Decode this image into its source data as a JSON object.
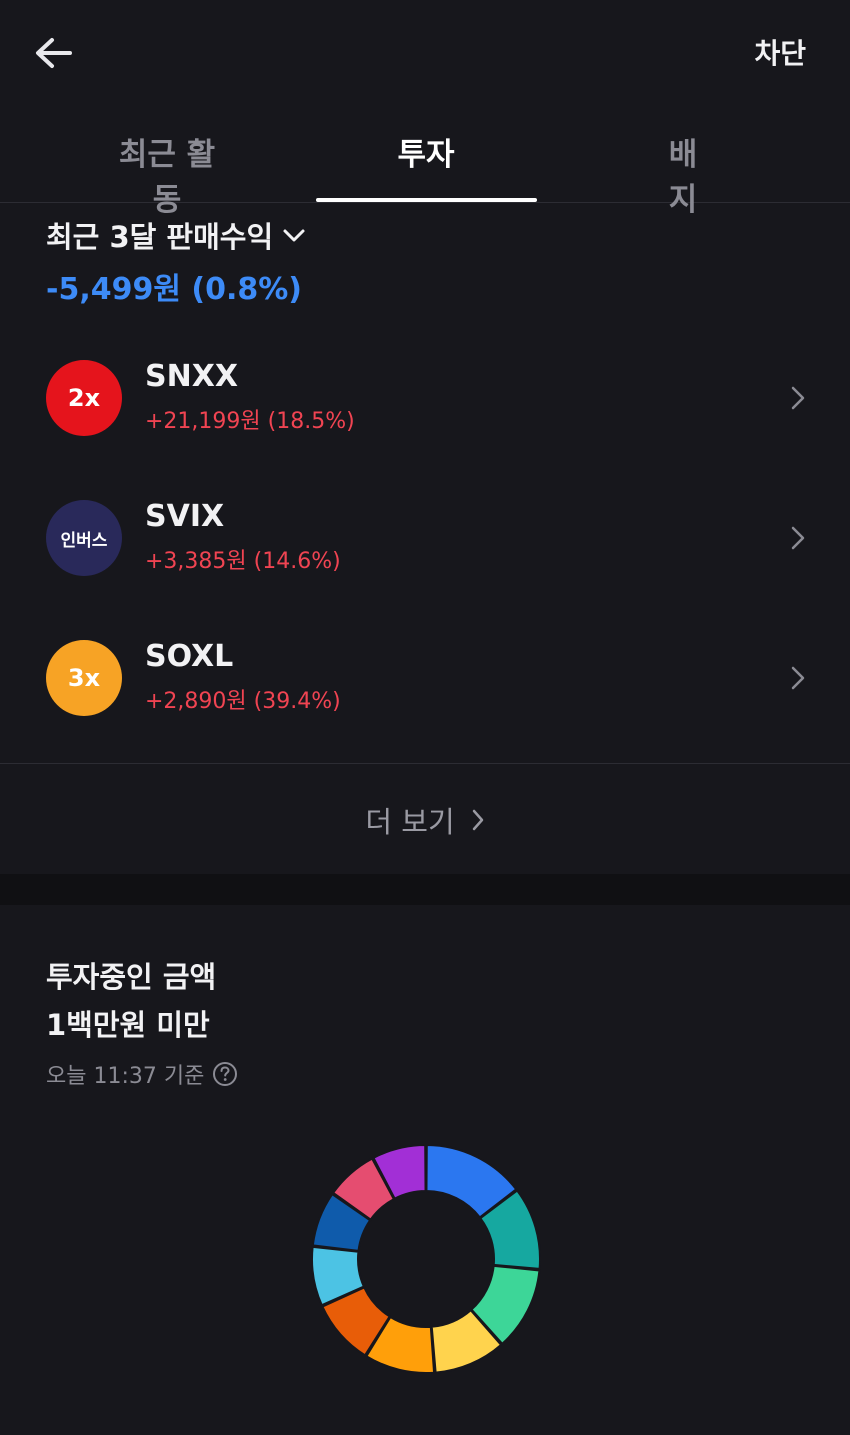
{
  "header": {
    "back_icon": "arrow-left-icon",
    "block_label": "차단"
  },
  "tabs": [
    {
      "label": "최근 활동",
      "active": false
    },
    {
      "label": "투자",
      "active": true
    },
    {
      "label": "배지",
      "active": false
    }
  ],
  "earnings": {
    "title": "최근 3달 판매수익",
    "value": "-5,499원 (0.8%)",
    "value_color": "#3d8bf7"
  },
  "stocks": [
    {
      "badge": "2x",
      "badge_color": "#e5141c",
      "ticker": "SNXX",
      "change": "+21,199원 (18.5%)"
    },
    {
      "badge": "인버스",
      "badge_color": "#29295a",
      "ticker": "SVIX",
      "change": "+3,385원 (14.6%)"
    },
    {
      "badge": "3x",
      "badge_color": "#f7a325",
      "ticker": "SOXL",
      "change": "+2,890원 (39.4%)"
    }
  ],
  "more": {
    "label": "더 보기"
  },
  "investment": {
    "title_line1": "투자중인 금액",
    "title_line2": "1백만원 미만",
    "timestamp": "오늘 11:37 기준",
    "help_icon": "question-circle-icon"
  },
  "donut_segments": [
    {
      "color": "#2b77f0",
      "share": 0.142
    },
    {
      "color": "#16a8a0",
      "share": 0.115
    },
    {
      "color": "#3dd698",
      "share": 0.116
    },
    {
      "color": "#ffd34d",
      "share": 0.1
    },
    {
      "color": "#ff9f0a",
      "share": 0.098
    },
    {
      "color": "#e85d08",
      "share": 0.091
    },
    {
      "color": "#4cc3e4",
      "share": 0.083
    },
    {
      "color": "#0f5bab",
      "share": 0.077
    },
    {
      "color": "#e54d70",
      "share": 0.073
    },
    {
      "color": "#a22fd6",
      "share": 0.075
    }
  ]
}
